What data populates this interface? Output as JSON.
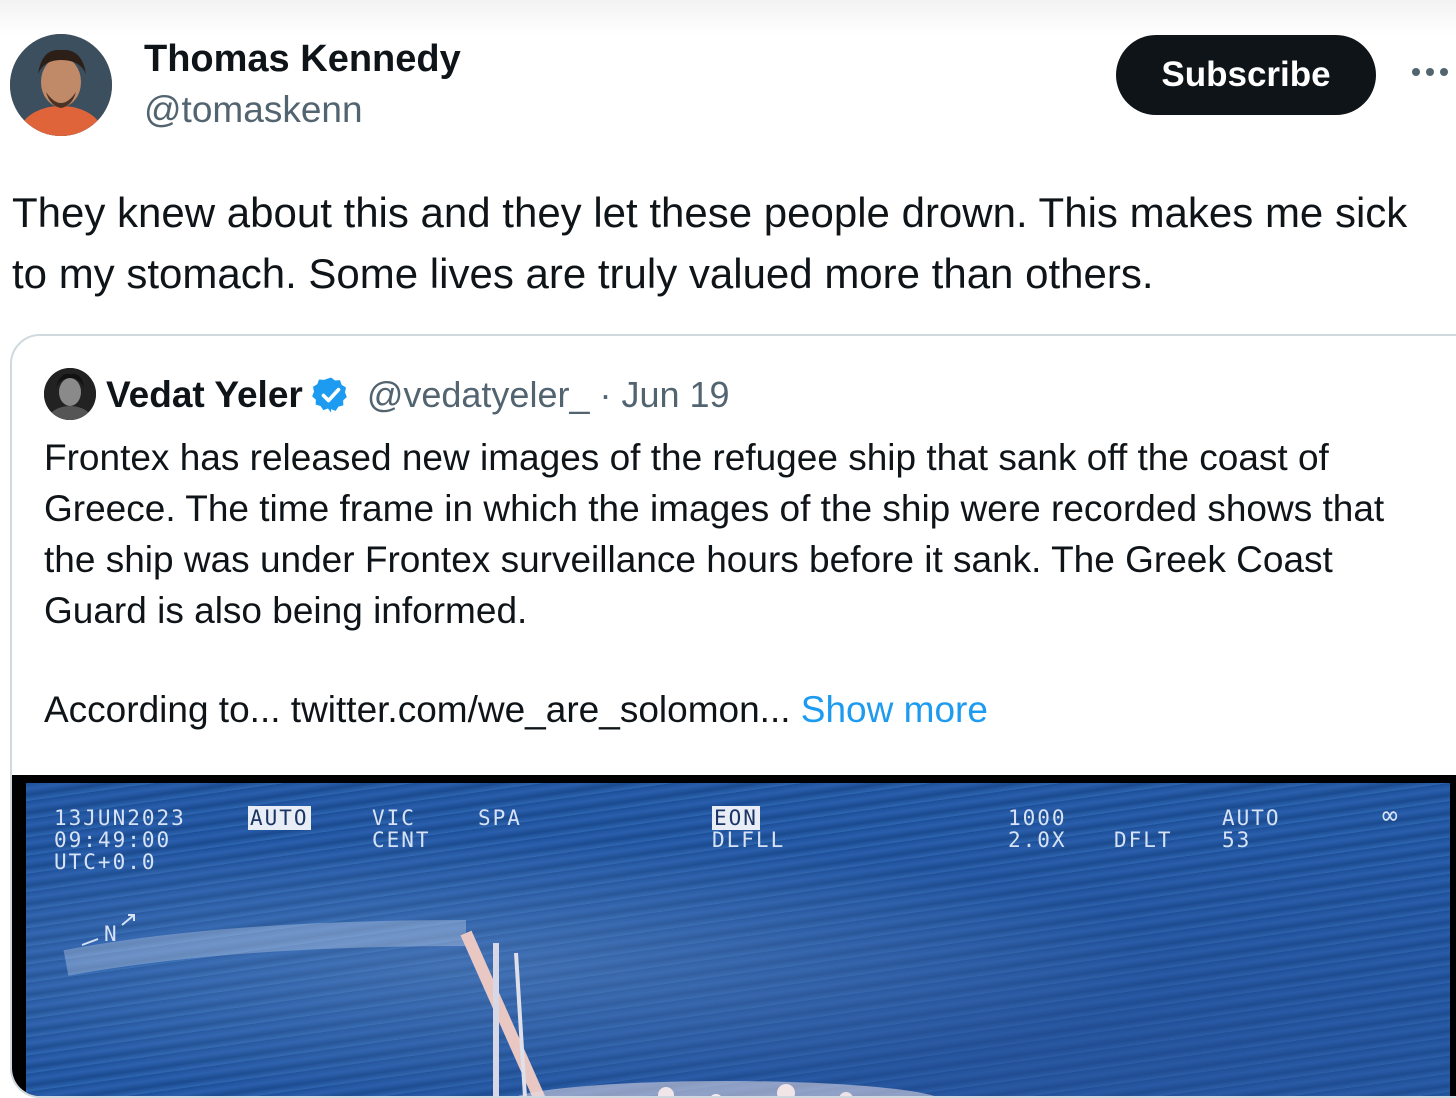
{
  "post": {
    "author_name": "Thomas Kennedy",
    "author_handle": "@tomaskenn",
    "subscribe_label": "Subscribe",
    "more_icon": "more-icon",
    "text": "They knew about this and they let these people drown. This makes me sick to my stomach. Some lives are truly valued more than others."
  },
  "quote": {
    "author_name": "Vedat Yeler",
    "verified_icon": "verified-badge-icon",
    "author_handle": "@vedatyeler_",
    "separator": "·",
    "date": "Jun 19",
    "text": "Frontex has released new images of the refugee ship that sank off the coast of Greece. The time frame in which the images of the ship were recorded shows that the ship was under Frontex surveillance hours before it sank. The Greek Coast Guard is also being informed.",
    "truncated_text": "According to...  twitter.com/we_are_solomon...",
    "show_more_label": "Show more"
  },
  "media": {
    "date": "13JUN2023",
    "time": "09:49:00",
    "tz": "UTC+0.0",
    "mode": "AUTO",
    "vic": "VIC",
    "cent": "CENT",
    "spa": "SPA",
    "eon": "EON",
    "dlfll": "DLFLL",
    "range": "1000",
    "zoom": "2.0X",
    "dflt": "DFLT",
    "auto2": "AUTO",
    "num": "53",
    "inf": "∞",
    "north": "N"
  },
  "colors": {
    "link": "#1d9bf0",
    "verified": "#1d9bf0",
    "button_bg": "#0f1419"
  }
}
